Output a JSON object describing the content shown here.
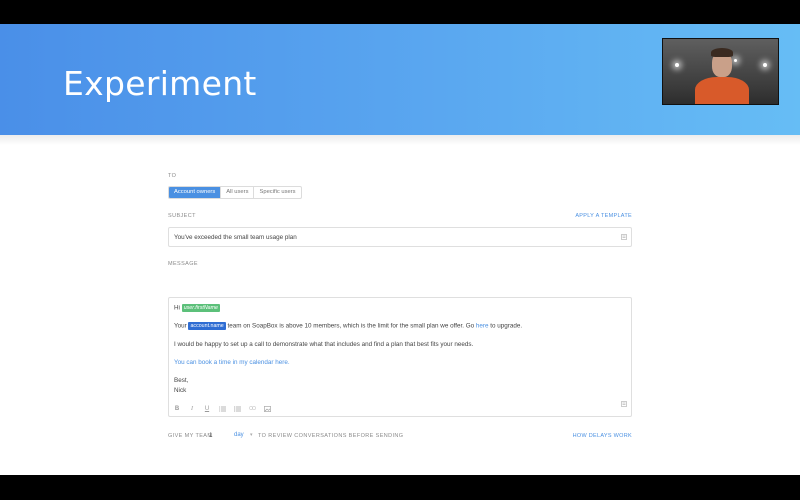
{
  "slide": {
    "title": "Experiment"
  },
  "form": {
    "to_label": "TO",
    "recipients": [
      "Account owners",
      "All users",
      "Specific users"
    ],
    "recipients_selected": 0,
    "subject_label": "SUBJECT",
    "apply_template": "APPLY A TEMPLATE",
    "subject_value": "You've exceeded the small team usage plan",
    "message_label": "MESSAGE",
    "message": {
      "greeting": "Hi",
      "var_first_name": "user.firstName",
      "line2_pre": "Your",
      "var_account_name": "account.name",
      "line2_post": "team on SoapBox is above 10 members, which is the limit for the small plan we offer. Go",
      "line2_link": "here",
      "line2_end": "to upgrade.",
      "line3": "I would be happy to set up a call to demonstrate what that includes and find a plan that best fits your needs.",
      "line4_link": "You can book a time in my calendar here.",
      "signoff": "Best,",
      "signature": "Nick"
    },
    "toolbar": [
      "bold-icon",
      "italic-icon",
      "underline-icon",
      "ordered-list-icon",
      "bullet-list-icon",
      "link-icon",
      "image-icon"
    ],
    "delay": {
      "prefix": "GIVE MY TEAM",
      "amount": "1",
      "unit": "day",
      "suffix": "TO REVIEW CONVERSATIONS BEFORE SENDING",
      "help_link": "HOW DELAYS WORK"
    }
  },
  "colors": {
    "accent": "#4a90e2",
    "variable_green": "#5cc07a",
    "variable_blue": "#2f6dd3"
  }
}
